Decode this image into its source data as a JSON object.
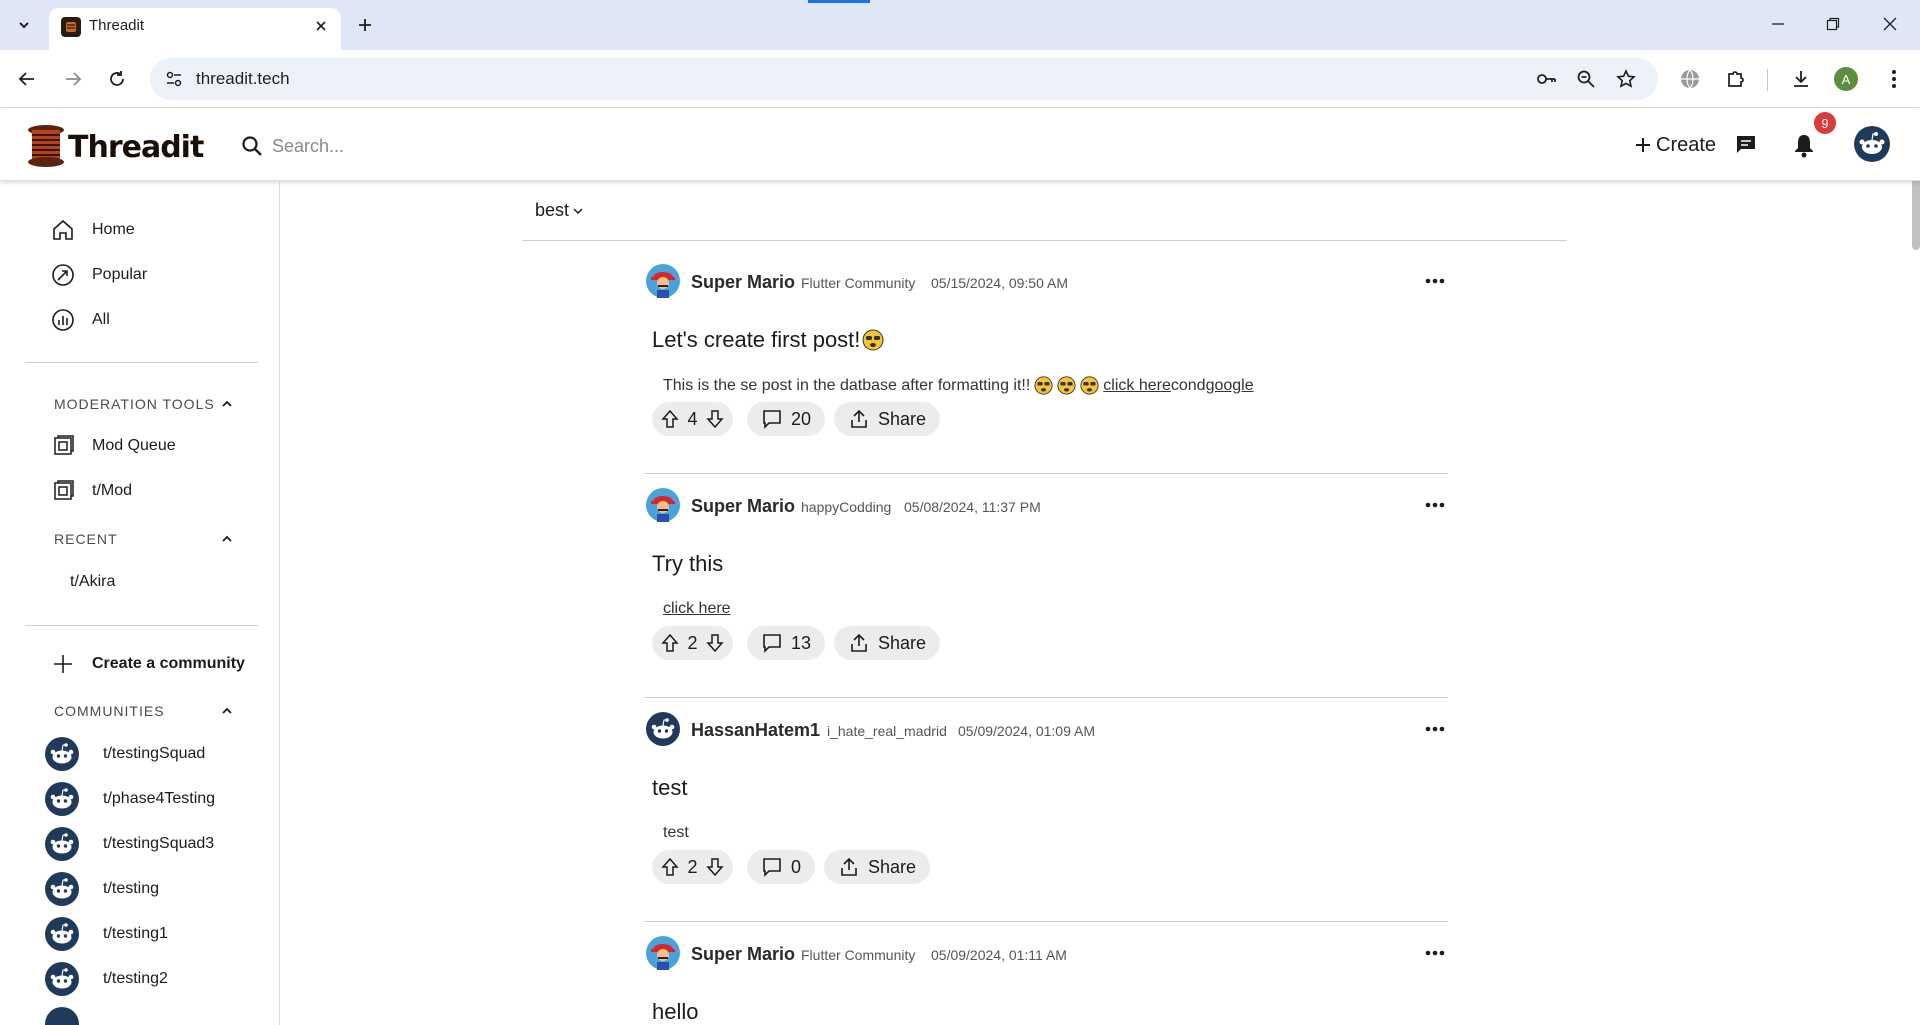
{
  "browser": {
    "tab_title": "Threadit",
    "url": "threadit.tech",
    "profile_initial": "A"
  },
  "header": {
    "logo_text": "Threadit",
    "search_placeholder": "Search...",
    "create_label": "Create",
    "notification_count": "9"
  },
  "sidebar": {
    "nav": [
      {
        "label": "Home",
        "icon": "home-icon"
      },
      {
        "label": "Popular",
        "icon": "popular-icon"
      },
      {
        "label": "All",
        "icon": "all-icon"
      }
    ],
    "moderation_title": "MODERATION TOOLS",
    "moderation_items": [
      {
        "label": "Mod Queue",
        "icon": "mod-queue-icon"
      },
      {
        "label": "t/Mod",
        "icon": "mod-icon"
      }
    ],
    "recent_title": "RECENT",
    "recent_items": [
      "t/Akira"
    ],
    "create_community_label": "Create a community",
    "communities_title": "COMMUNITIES",
    "communities": [
      "t/testingSquad",
      "t/phase4Testing",
      "t/testingSquad3",
      "t/testing",
      "t/testing1",
      "t/testing2"
    ]
  },
  "feed": {
    "sort_label": "best",
    "posts": [
      {
        "author": "Super Mario",
        "community": "Flutter Community",
        "time": "05/15/2024, 09:50 AM",
        "title": "Let's create first post!",
        "body_text": "This is the se post in the datbase after formatting it!!",
        "link1": "click here",
        "body_mid": "cond",
        "link2": "google",
        "votes": "4",
        "comments": "20",
        "share": "Share"
      },
      {
        "author": "Super Mario",
        "community": "happyCodding",
        "time": "05/08/2024, 11:37 PM",
        "title": "Try this",
        "link1": "click here",
        "votes": "2",
        "comments": "13",
        "share": "Share"
      },
      {
        "author": "HassanHatem1",
        "community": "i_hate_real_madrid",
        "time": "05/09/2024, 01:09 AM",
        "title": "test",
        "body_text": "test",
        "votes": "2",
        "comments": "0",
        "share": "Share"
      },
      {
        "author": "Super Mario",
        "community": "Flutter Community",
        "time": "05/09/2024, 01:11 AM",
        "title": "hello"
      }
    ]
  },
  "colors": {
    "tabstrip": "#dfe7f6",
    "badge": "#d93a3a",
    "pill": "#ececec",
    "snoo_bg": "#1f3a5a"
  }
}
